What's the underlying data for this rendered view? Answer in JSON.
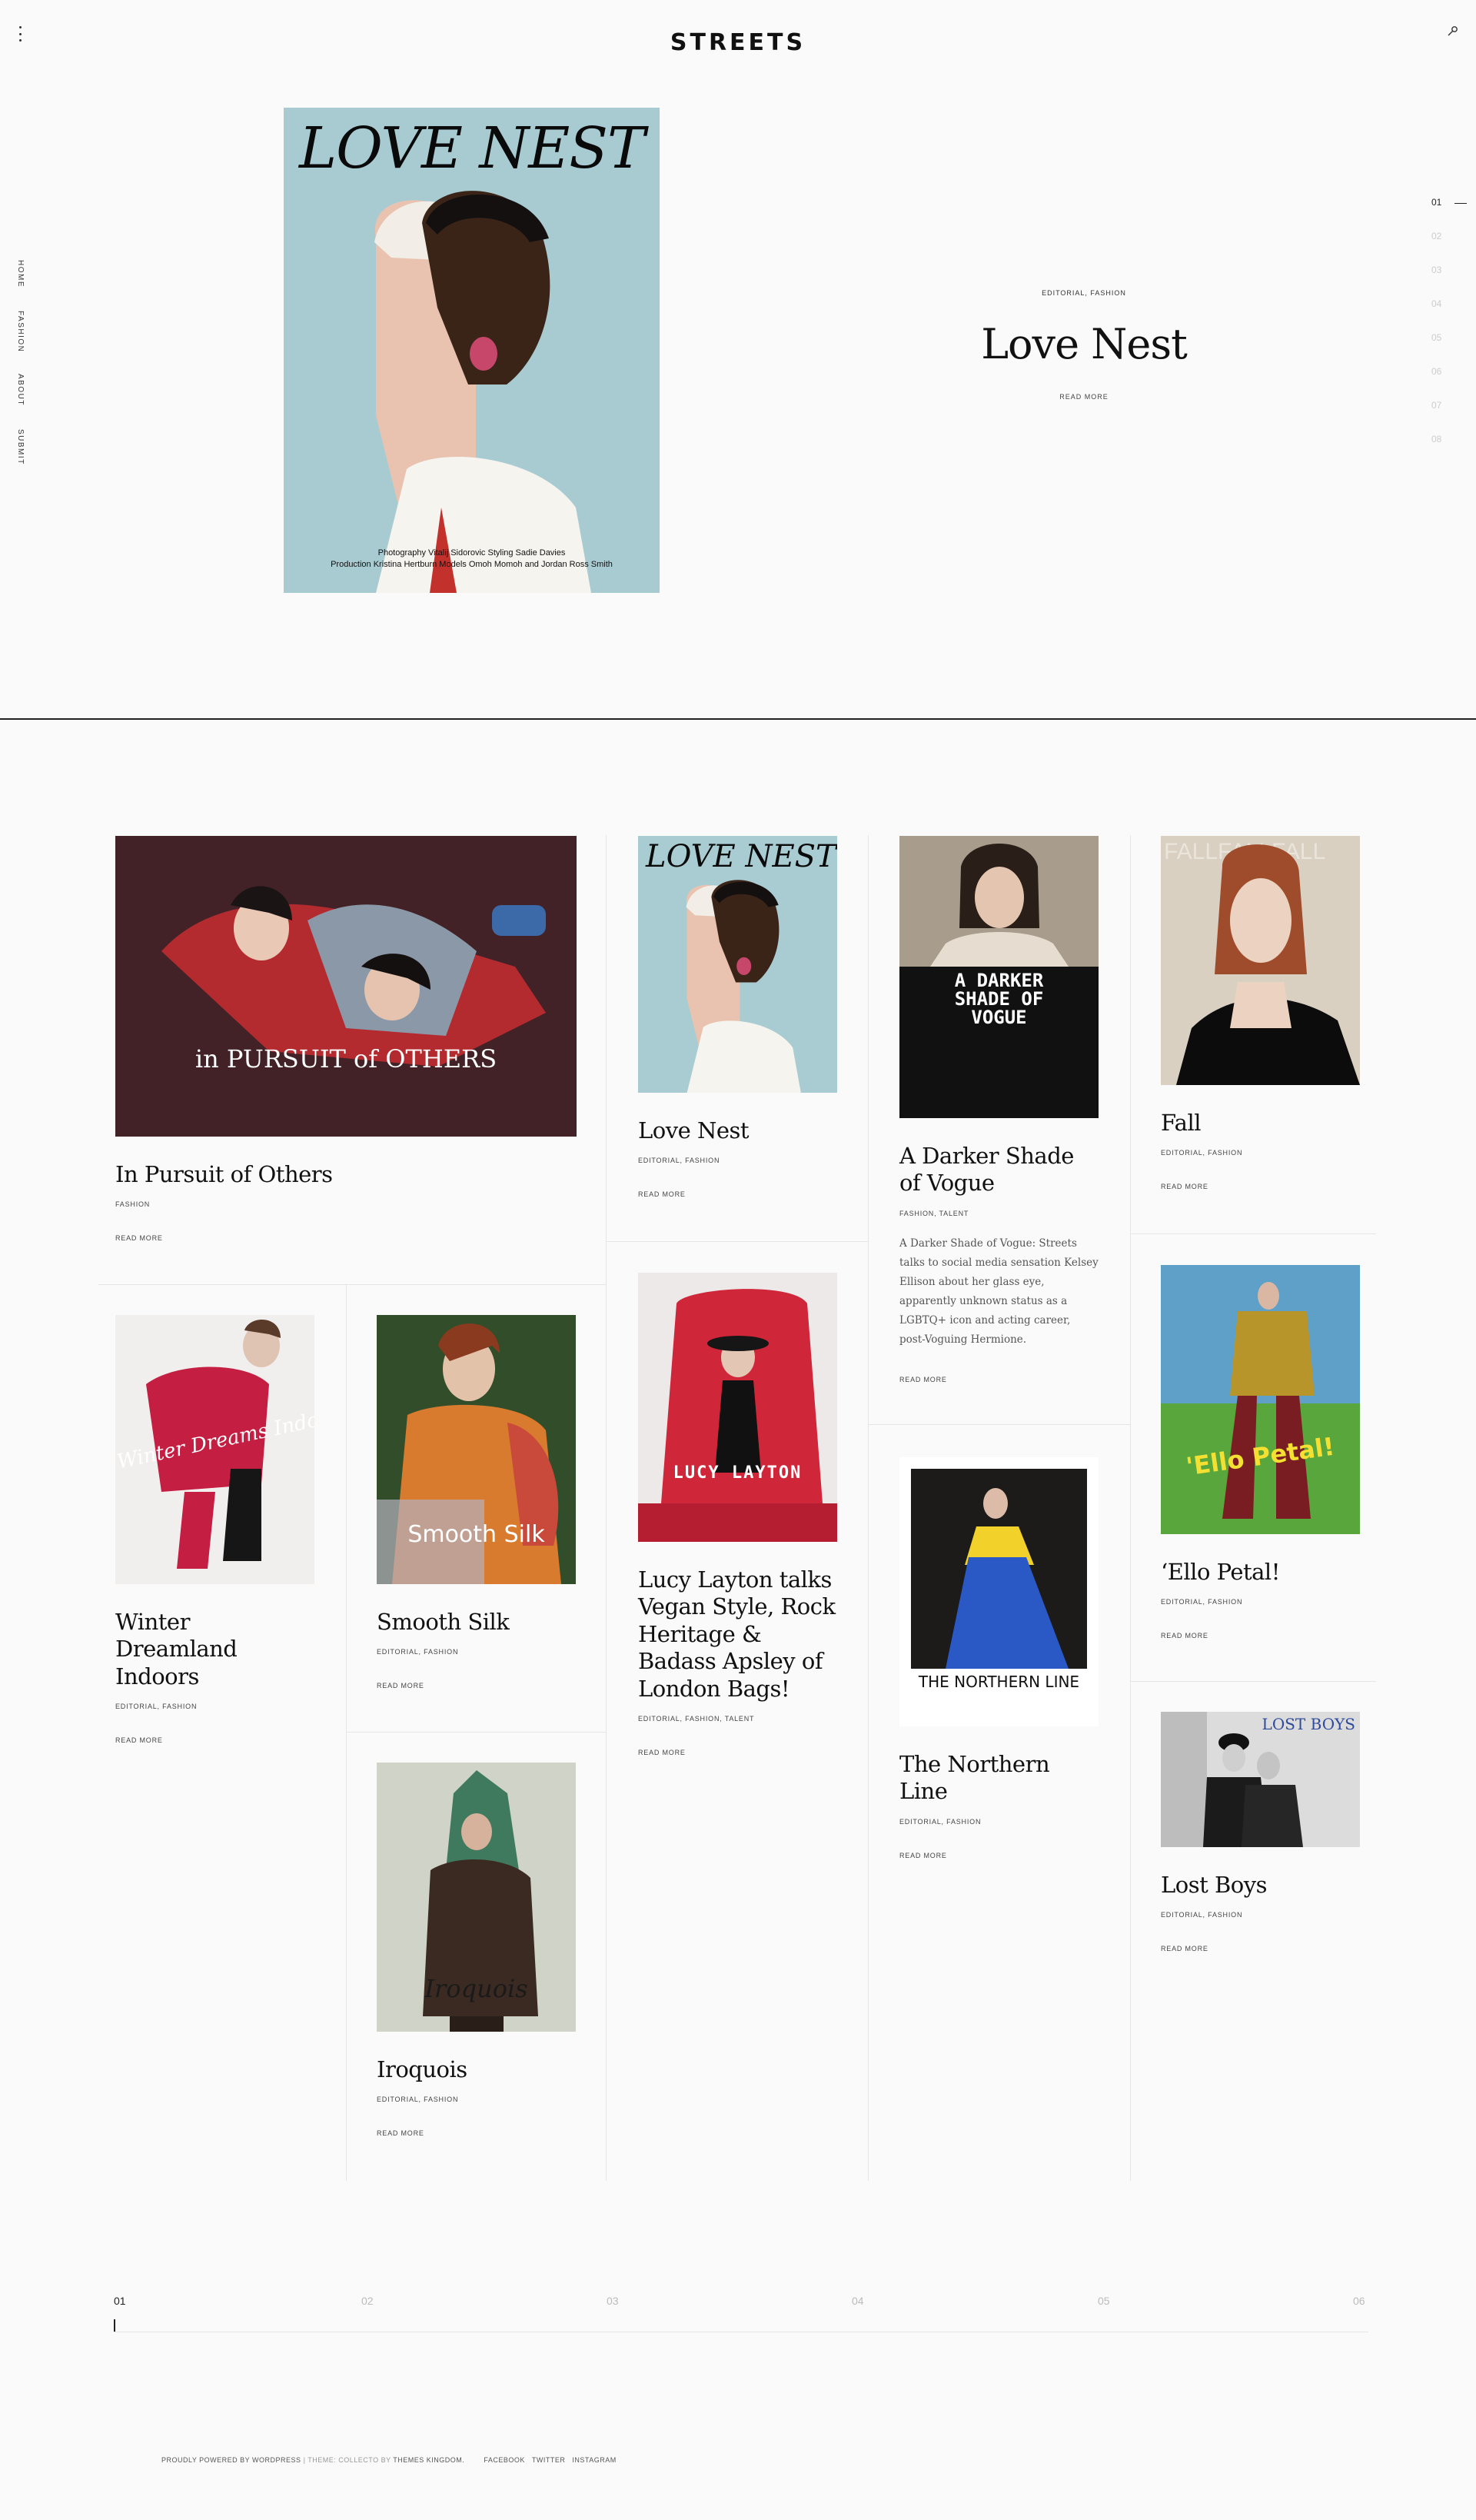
{
  "site": {
    "logo": "STREETS"
  },
  "sidenav": [
    "HOME",
    "FASHION",
    "ABOUT",
    "SUBMIT"
  ],
  "slider": {
    "numbers": [
      "01",
      "02",
      "03",
      "04",
      "05",
      "06",
      "07",
      "08"
    ],
    "active_index": 0,
    "cover": {
      "title": "LOVE NEST",
      "credit_line1": "Photography Vitalij Sidorovic Styling Sadie Davies",
      "credit_line2": "Production Kristina Hertburn Models Omoh Momoh and Jordan Ross Smith"
    },
    "tags": "EDITORIAL, FASHION",
    "title": "Love Nest",
    "read_more": "READ MORE"
  },
  "posts": [
    {
      "title": "In Pursuit of Others",
      "tags": "FASHION",
      "read_more": "READ MORE",
      "cover_text": "in PURSUIT of OTHERS"
    },
    {
      "title": "Love Nest",
      "tags": "EDITORIAL, FASHION",
      "read_more": "READ MORE",
      "cover_text": "LOVE NEST"
    },
    {
      "title": "A Darker Shade of Vogue",
      "tags": "FASHION, TALENT",
      "read_more": "READ MORE",
      "cover_text": "A DARKER SHADE OF VOGUE",
      "excerpt": "A Darker Shade of Vogue: Streets talks to social media sensation Kelsey Ellison about her glass eye, apparently unknown status as a LGBTQ+ icon and acting career, post-Voguing Hermione."
    },
    {
      "title": "Fall",
      "tags": "EDITORIAL, FASHION",
      "read_more": "READ MORE",
      "cover_text": "FALLFALLFALL"
    },
    {
      "title": "Winter Dreamland Indoors",
      "tags": "EDITORIAL, FASHION",
      "read_more": "READ MORE",
      "cover_text": "Winter Dreams Indoors"
    },
    {
      "title": "Smooth Silk",
      "tags": "EDITORIAL, FASHION",
      "read_more": "READ MORE",
      "cover_text": "Smooth Silk"
    },
    {
      "title": "Lucy Layton talks Vegan Style, Rock Heritage & Badass Apsley of London Bags!",
      "tags": "EDITORIAL, FASHION, TALENT",
      "read_more": "READ MORE",
      "cover_text": "LUCY LAYTON"
    },
    {
      "title": "The Northern Line",
      "tags": "EDITORIAL, FASHION",
      "read_more": "READ MORE",
      "cover_text": "THE NORTHERN LINE"
    },
    {
      "title": "‘Ello Petal!",
      "tags": "EDITORIAL, FASHION",
      "read_more": "READ MORE",
      "cover_text": "'Ello Petal!"
    },
    {
      "title": "Iroquois",
      "tags": "EDITORIAL, FASHION",
      "read_more": "READ MORE",
      "cover_text": "Iroquois"
    },
    {
      "title": "Lost Boys",
      "tags": "EDITORIAL, FASHION",
      "read_more": "READ MORE",
      "cover_text": "LOST BOYS"
    }
  ],
  "pager": {
    "pages": [
      "01",
      "02",
      "03",
      "04",
      "05",
      "06"
    ],
    "active": "01"
  },
  "footer": {
    "powered": "PROUDLY POWERED BY WORDPRESS",
    "theme": "| THEME: COLLECTO BY",
    "vendor": "THEMES KINGDOM.",
    "links": [
      "FACEBOOK",
      "TWITTER",
      "INSTAGRAM"
    ]
  },
  "colors": {
    "accent": "#111111",
    "background": "#fafafa",
    "muted": "#cccccc",
    "divider": "#e6e6e6"
  },
  "icons": {
    "menu": "vertical-dots-icon",
    "search": "search-icon"
  }
}
